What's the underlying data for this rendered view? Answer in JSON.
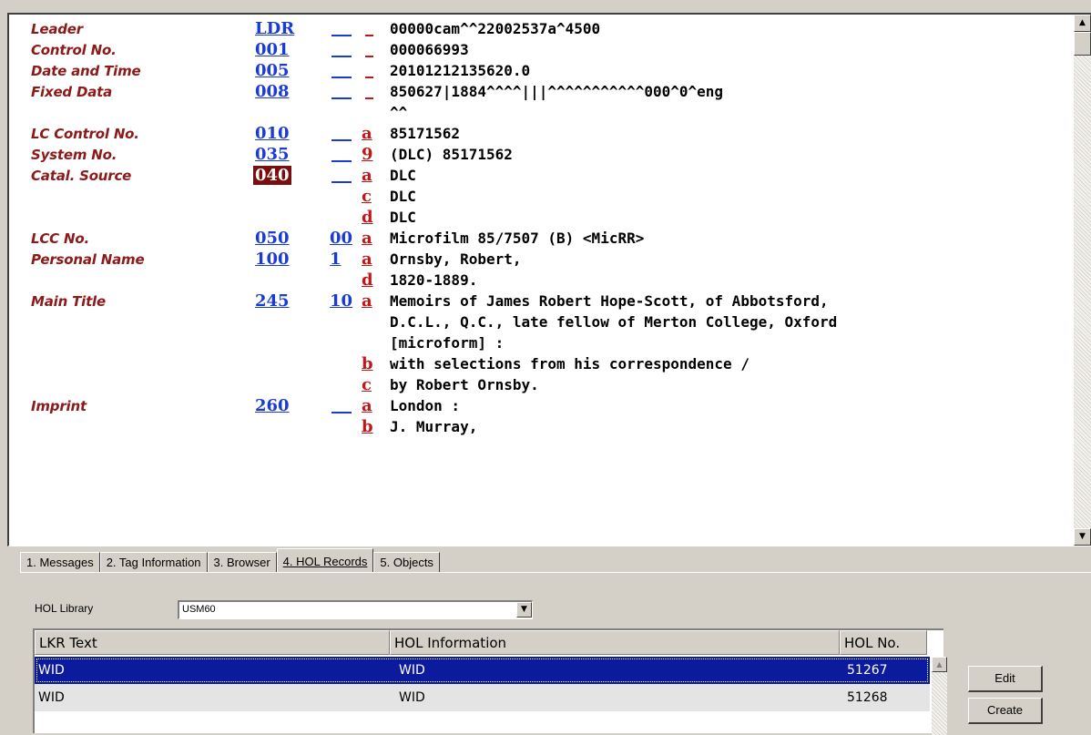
{
  "record": {
    "rows": [
      {
        "label": "Leader",
        "tag": "LDR",
        "ind": "",
        "sub": "",
        "value": "00000cam^^22002537a^4500"
      },
      {
        "label": "Control No.",
        "tag": "001",
        "ind": "",
        "sub": "",
        "value": "000066993"
      },
      {
        "label": "Date and Time",
        "tag": "005",
        "ind": "",
        "sub": "",
        "value": "20101212135620.0"
      },
      {
        "label": "Fixed Data",
        "tag": "008",
        "ind": "",
        "sub": "",
        "value": "850627|1884^^^^|||^^^^^^^^^^^000^0^eng"
      },
      {
        "label": "",
        "tag": "",
        "ind": "",
        "sub": "",
        "value": "^^"
      },
      {
        "label": "LC Control No.",
        "tag": "010",
        "ind": "",
        "sub": "a",
        "value": "85171562"
      },
      {
        "label": "System No.",
        "tag": "035",
        "ind": "",
        "sub": "9",
        "value": "(DLC) 85171562"
      },
      {
        "label": "Catal. Source",
        "tag": "040",
        "ind": "",
        "sub": "a",
        "value": "DLC"
      },
      {
        "label": "",
        "tag": "",
        "ind": "",
        "sub": "c",
        "value": "DLC"
      },
      {
        "label": "",
        "tag": "",
        "ind": "",
        "sub": "d",
        "value": "DLC"
      },
      {
        "label": "LCC No.",
        "tag": "050",
        "ind": "00",
        "sub": "a",
        "value": "Microfilm 85/7507 (B) <MicRR>"
      },
      {
        "label": "Personal Name",
        "tag": "100",
        "ind": "1",
        "sub": "a",
        "value": "Ornsby, Robert,"
      },
      {
        "label": "",
        "tag": "",
        "ind": "",
        "sub": "d",
        "value": "1820-1889."
      },
      {
        "label": "Main Title",
        "tag": "245",
        "ind": "10",
        "sub": "a",
        "value": "Memoirs of James Robert Hope-Scott, of Abbotsford,"
      },
      {
        "label": "",
        "tag": "",
        "ind": "",
        "sub": "",
        "value": "D.C.L., Q.C., late fellow of Merton College, Oxford"
      },
      {
        "label": "",
        "tag": "",
        "ind": "",
        "sub": "",
        "value": "[microform] :"
      },
      {
        "label": "",
        "tag": "",
        "ind": "",
        "sub": "b",
        "value": "with selections from his correspondence /"
      },
      {
        "label": "",
        "tag": "",
        "ind": "",
        "sub": "c",
        "value": "by Robert Ornsby."
      },
      {
        "label": "Imprint",
        "tag": "260",
        "ind": "",
        "sub": "a",
        "value": "London :"
      },
      {
        "label": "",
        "tag": "",
        "ind": "",
        "sub": "b",
        "value": "J. Murray,"
      }
    ]
  },
  "tabs": [
    "1. Messages",
    "2. Tag Information",
    "3. Browser",
    "4. HOL Records",
    "5. Objects"
  ],
  "active_tab": "4. HOL Records",
  "hol": {
    "library_label": "HOL Library",
    "library_value": "USM60",
    "columns": [
      "LKR Text",
      "HOL Information",
      "HOL No."
    ],
    "rows": [
      {
        "lkr": "WID",
        "info": "WID",
        "no": "51267"
      },
      {
        "lkr": "WID",
        "info": "WID",
        "no": "51268"
      }
    ]
  },
  "buttons": {
    "edit": "Edit",
    "create": "Create"
  },
  "colors": {
    "label": "#8b1a1a",
    "tag": "#1a3bd6",
    "subfield": "#c01818",
    "selected_tag": "#7a0d0d",
    "selection": "#0c1b9e"
  }
}
